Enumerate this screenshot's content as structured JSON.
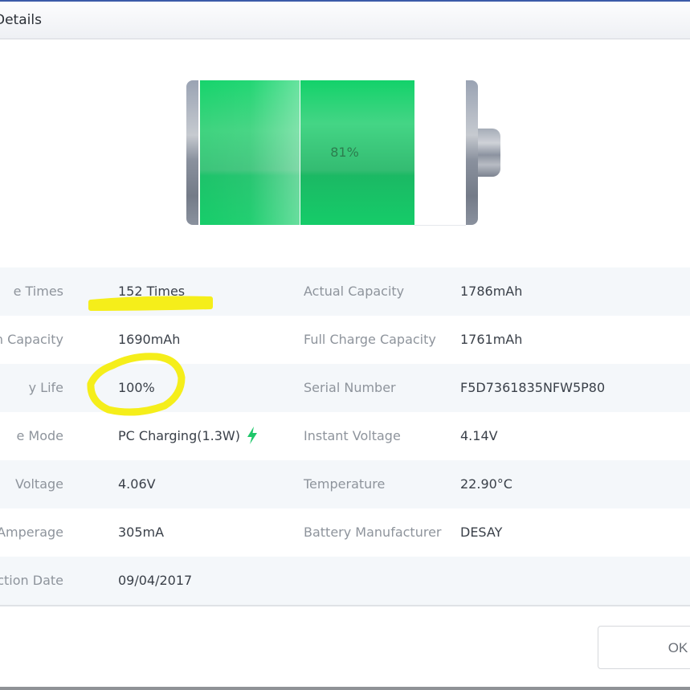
{
  "window": {
    "title": "Details"
  },
  "battery": {
    "charge_percent": 81,
    "charge_label": "81%"
  },
  "details": {
    "rows": [
      {
        "left_label": "e Times",
        "left_value": "152 Times",
        "right_label": "Actual Capacity",
        "right_value": "1786mAh"
      },
      {
        "left_label": "n Capacity",
        "left_value": "1690mAh",
        "right_label": "Full Charge Capacity",
        "right_value": "1761mAh"
      },
      {
        "left_label": "y Life",
        "left_value": "100%",
        "right_label": "Serial Number",
        "right_value": "F5D7361835NFW5P80"
      },
      {
        "left_label": "e Mode",
        "left_value": "PC Charging(1.3W)",
        "right_label": "Instant Voltage",
        "right_value": "4.14V"
      },
      {
        "left_label": "Voltage",
        "left_value": "4.06V",
        "right_label": "Temperature",
        "right_value": "22.90°C"
      },
      {
        "left_label": "t Amperage",
        "left_value": "305mA",
        "right_label": "Battery Manufacturer",
        "right_value": "DESAY"
      },
      {
        "left_label": "ction Date",
        "left_value": "09/04/2017",
        "right_label": "",
        "right_value": ""
      }
    ],
    "charging_icon": "lightning-bolt-icon",
    "accent_color": "#1fc76a"
  },
  "annotations": {
    "highlight_color": "#f5ee1a"
  },
  "footer": {
    "ok_label": "OK"
  }
}
